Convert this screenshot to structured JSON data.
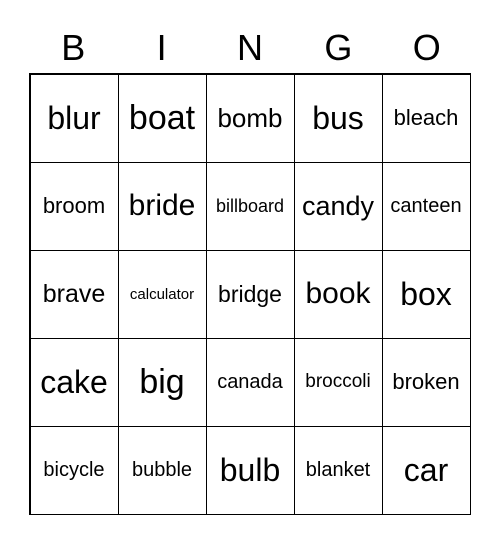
{
  "header": [
    "B",
    "I",
    "N",
    "G",
    "O"
  ],
  "cells": [
    [
      "blur",
      "boat",
      "bomb",
      "bus",
      "bleach"
    ],
    [
      "broom",
      "bride",
      "billboard",
      "candy",
      "canteen"
    ],
    [
      "brave",
      "calculator",
      "bridge",
      "book",
      "box"
    ],
    [
      "cake",
      "big",
      "canada",
      "broccoli",
      "broken"
    ],
    [
      "bicycle",
      "bubble",
      "bulb",
      "blanket",
      "car"
    ]
  ]
}
